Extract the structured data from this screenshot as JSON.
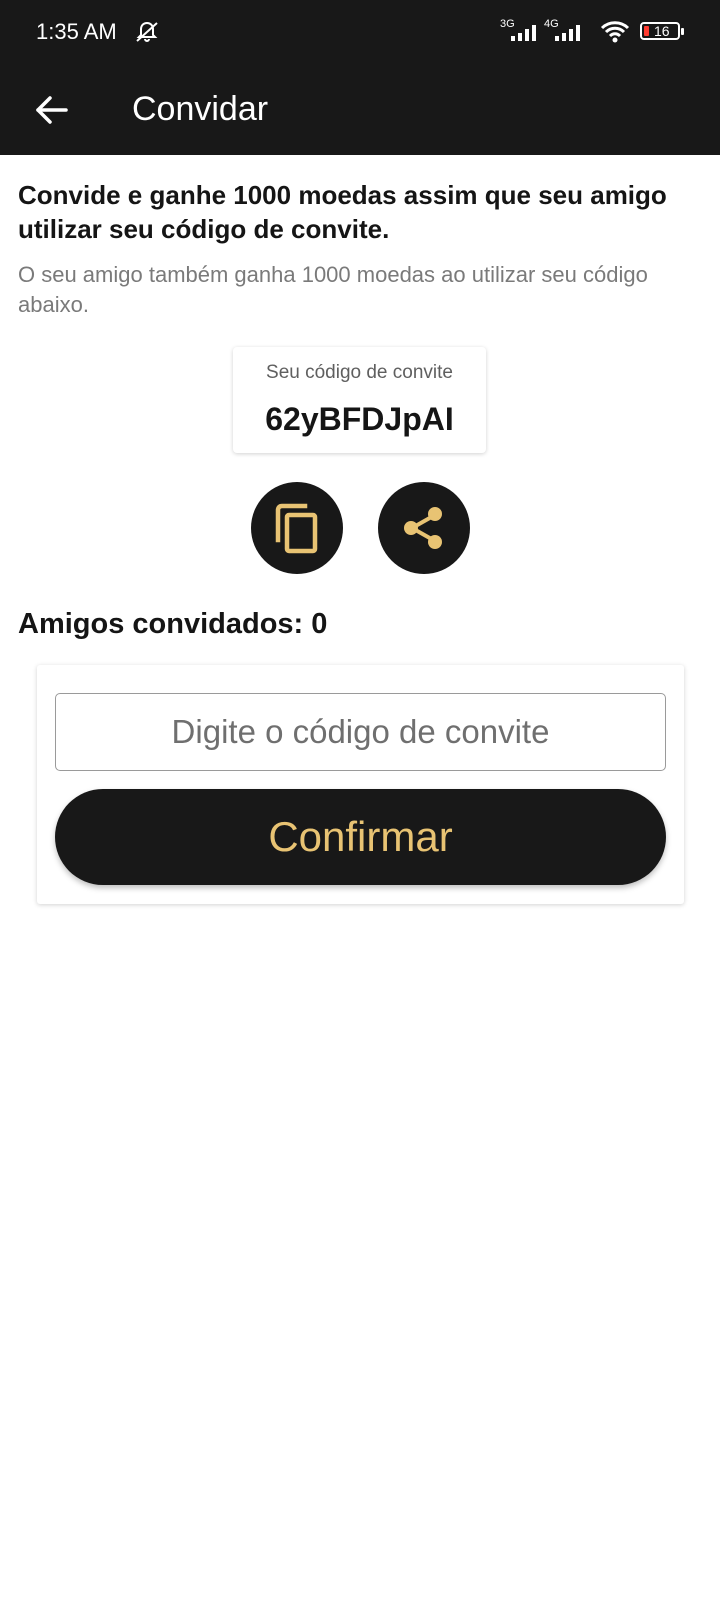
{
  "status_bar": {
    "time": "1:35 AM",
    "network_1": "3G",
    "network_2": "4G",
    "battery": "16",
    "icons": [
      "notifications-off-icon",
      "signal-icon",
      "wifi-icon",
      "battery-icon"
    ]
  },
  "app_bar": {
    "title": "Convidar",
    "back_icon": "arrow-back-icon"
  },
  "main": {
    "headline": "Convide e ganhe 1000 moedas assim que seu amigo utilizar seu código de convite.",
    "subtext": "O seu amigo também ganha 1000 moedas ao utilizar seu código abaixo.",
    "code_label": "Seu código de convite",
    "code_value": "62yBFDJpAI",
    "copy_icon": "copy-icon",
    "share_icon": "share-icon",
    "friends_label": "Amigos convidados:",
    "friends_count": "0"
  },
  "form": {
    "placeholder": "Digite o código de convite",
    "value": "",
    "confirm_label": "Confirmar"
  },
  "colors": {
    "dark": "#181818",
    "accent_gold": "#e8c373",
    "battery_low": "#ff3b30"
  }
}
